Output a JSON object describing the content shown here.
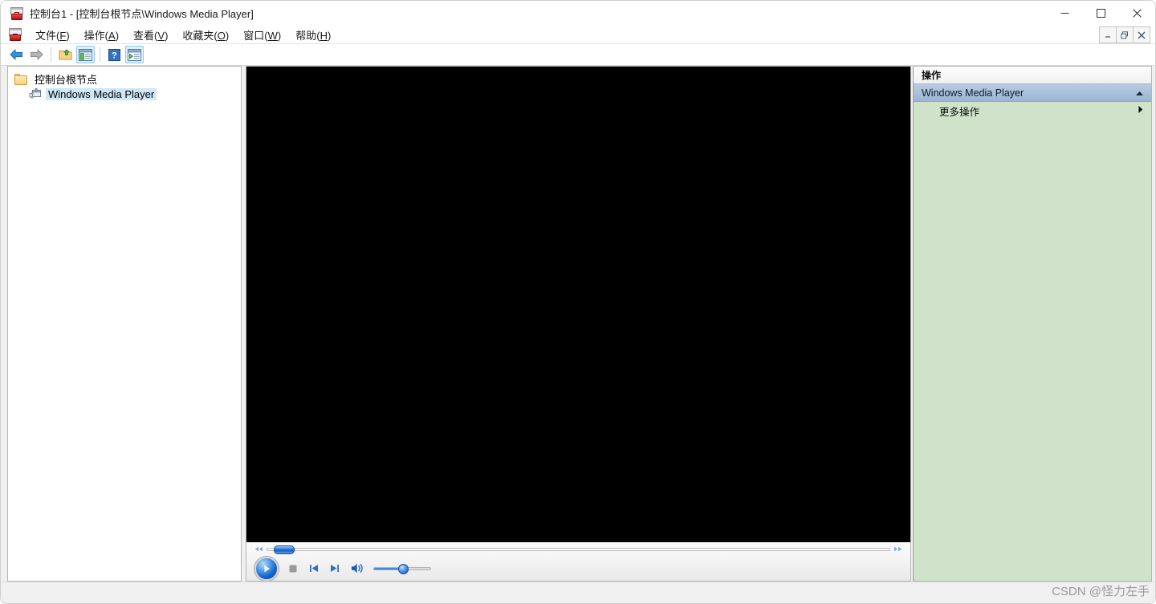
{
  "window": {
    "title": "控制台1 - [控制台根节点\\Windows Media Player]",
    "icon": "mmc-console-icon",
    "controls": {
      "minimize": "minimize-icon",
      "maximize": "maximize-icon",
      "close": "close-icon"
    },
    "mdi_controls": {
      "minimize": "mdi-minimize-icon",
      "restore": "mdi-restore-icon",
      "close": "mdi-close-icon"
    }
  },
  "menu": {
    "items": [
      {
        "label": "文件",
        "accel": "F"
      },
      {
        "label": "操作",
        "accel": "A"
      },
      {
        "label": "查看",
        "accel": "V"
      },
      {
        "label": "收藏夹",
        "accel": "O"
      },
      {
        "label": "窗口",
        "accel": "W"
      },
      {
        "label": "帮助",
        "accel": "H"
      }
    ]
  },
  "toolbar": {
    "buttons": [
      {
        "name": "back-arrow-icon",
        "enabled": true
      },
      {
        "name": "forward-arrow-icon",
        "enabled": false
      },
      {
        "name": "up-one-level-folder-icon",
        "enabled": true
      },
      {
        "name": "show-hide-console-tree-icon",
        "enabled": true,
        "active": true
      },
      {
        "name": "help-question-icon",
        "enabled": true
      },
      {
        "name": "export-list-icon",
        "enabled": true,
        "active": true
      }
    ]
  },
  "tree": {
    "nodes": [
      {
        "label": "控制台根节点",
        "icon": "folder-icon",
        "selected": false,
        "level": 0
      },
      {
        "label": "Windows Media Player",
        "icon": "snapin-icon",
        "selected": true,
        "level": 1
      }
    ]
  },
  "player": {
    "video_background": "#000000",
    "seek": {
      "rewind_icon": "rewind-icon",
      "fastforward_icon": "fastforward-icon",
      "position_percent": 1
    },
    "buttons": [
      {
        "name": "play-button",
        "icon": "play-icon"
      },
      {
        "name": "stop-button",
        "icon": "stop-icon"
      },
      {
        "name": "previous-button",
        "icon": "previous-track-icon"
      },
      {
        "name": "next-button",
        "icon": "next-track-icon"
      },
      {
        "name": "mute-button",
        "icon": "volume-speaker-icon"
      }
    ],
    "volume_percent": 52
  },
  "actions": {
    "title": "操作",
    "groups": [
      {
        "header": "Windows Media Player",
        "collapse_icon": "chevron-up-icon",
        "items": [
          {
            "label": "更多操作",
            "submenu_icon": "chevron-right-icon"
          }
        ]
      }
    ],
    "background_color": "#cfe3cb",
    "header_color": "#a9c1da"
  },
  "watermark": {
    "text": "CSDN @怪力左手"
  }
}
